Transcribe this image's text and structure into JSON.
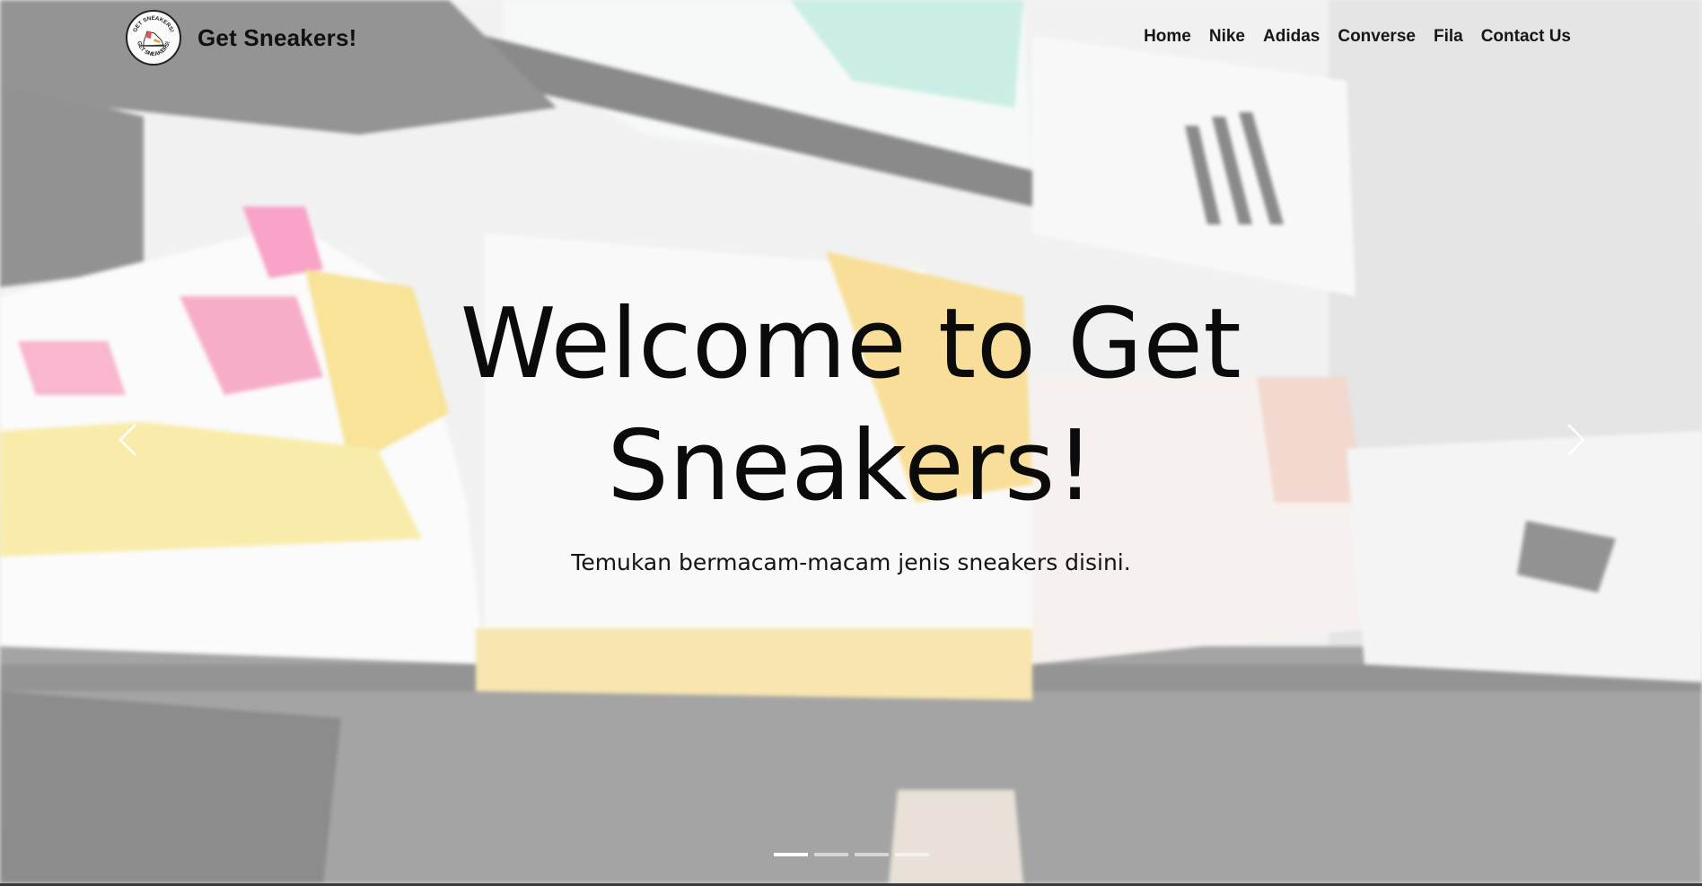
{
  "brand": {
    "name": "Get Sneakers!",
    "logo_icon": "sneaker-logo-icon",
    "logo_ring_text": "GET SNEAKERS!"
  },
  "nav": {
    "items": [
      {
        "label": "Home"
      },
      {
        "label": "Nike"
      },
      {
        "label": "Adidas"
      },
      {
        "label": "Converse"
      },
      {
        "label": "Fila"
      },
      {
        "label": "Contact Us"
      }
    ]
  },
  "hero": {
    "title": "Welcome to Get Sneakers!",
    "subtitle": "Temukan bermacam-macam jenis sneakers disini."
  },
  "carousel": {
    "prev_icon": "chevron-left-icon",
    "next_icon": "chevron-right-icon",
    "slide_count": 4,
    "active_index": 0
  },
  "colors": {
    "text": "#111111",
    "accent_pink": "#f05a96",
    "accent_yellow": "#f2c84b",
    "accent_teal": "#7fd6c4"
  }
}
